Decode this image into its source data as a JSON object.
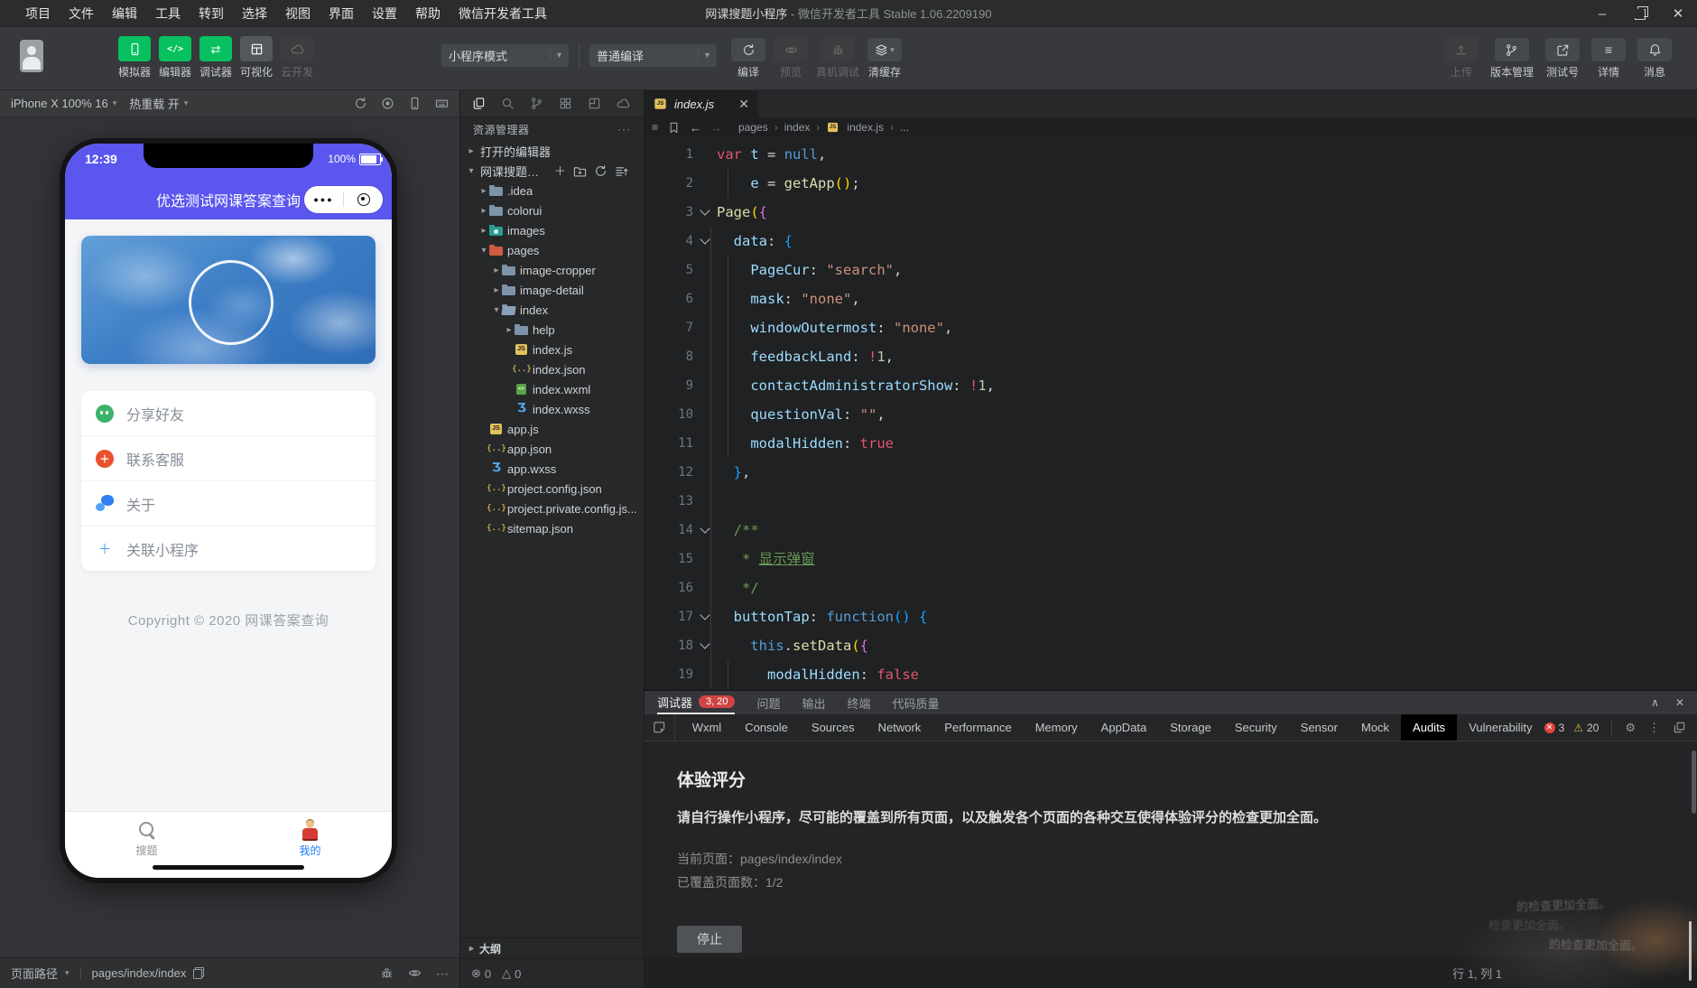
{
  "colors": {
    "accent_green": "#07c160",
    "phone_header_purple": "#5a56ee",
    "badge_red": "#d04444",
    "error_red": "#e2443f",
    "warning_yellow": "#e2b341",
    "active_tab_blue": "#1f7bf6"
  },
  "titlebar": {
    "menus": [
      "项目",
      "文件",
      "编辑",
      "工具",
      "转到",
      "选择",
      "视图",
      "界面",
      "设置",
      "帮助",
      "微信开发者工具"
    ],
    "title_main": "网课搜题小程序",
    "title_rest": "- 微信开发者工具 Stable 1.06.2209190"
  },
  "toolbar": {
    "big_buttons": [
      {
        "label": "模拟器",
        "icon": "device",
        "style": "green"
      },
      {
        "label": "编辑器",
        "icon": "code",
        "style": "green"
      },
      {
        "label": "调试器",
        "icon": "swap",
        "style": "green"
      },
      {
        "label": "可视化",
        "icon": "grid",
        "style": "gray"
      },
      {
        "label": "云开发",
        "icon": "cloud",
        "style": "disabled"
      }
    ],
    "mode_select": "小程序模式",
    "compile_select": "普通编译",
    "action_buttons": [
      {
        "label": "编译",
        "icon": "refresh",
        "state": "normal",
        "caret": false
      },
      {
        "label": "预览",
        "icon": "eye",
        "state": "disabled",
        "caret": false
      },
      {
        "label": "真机调试",
        "icon": "bug",
        "state": "disabled",
        "caret": false
      },
      {
        "label": "清缓存",
        "icon": "layers",
        "state": "normal",
        "caret": true
      }
    ],
    "right_buttons": [
      {
        "label": "上传",
        "icon": "upload",
        "state": "disabled"
      },
      {
        "label": "版本管理",
        "icon": "branch",
        "state": "normal"
      },
      {
        "label": "测试号",
        "icon": "extern",
        "state": "normal"
      },
      {
        "label": "详情",
        "icon": "list",
        "state": "normal"
      },
      {
        "label": "消息",
        "icon": "bell",
        "state": "normal"
      }
    ]
  },
  "simulator": {
    "device_label": "iPhone X 100% 16",
    "hot_reload_label": "热重载 开",
    "phone": {
      "time": "12:39",
      "battery": "100%",
      "nav_title": "优选测试网课答案查询",
      "menu": [
        {
          "label": "分享好友",
          "icon": "share"
        },
        {
          "label": "联系客服",
          "icon": "contact"
        },
        {
          "label": "关于",
          "icon": "about"
        },
        {
          "label": "关联小程序",
          "icon": "plus"
        }
      ],
      "copyright": "Copyright © 2020 网课答案查询",
      "tabbar": [
        {
          "label": "搜题",
          "icon": "search",
          "active": false
        },
        {
          "label": "我的",
          "icon": "me",
          "active": true
        }
      ]
    },
    "status": {
      "path_label": "页面路径",
      "path": "pages/index/index"
    }
  },
  "explorer": {
    "header": "资源管理器",
    "tree": [
      {
        "label": "打开的编辑器",
        "depth": 0,
        "arrow": "right",
        "icon": ""
      },
      {
        "label": "网课搜题小...",
        "depth": 0,
        "arrow": "down",
        "icon": "",
        "root": true
      },
      {
        "label": ".idea",
        "depth": 1,
        "arrow": "right",
        "icon": "folder"
      },
      {
        "label": "colorui",
        "depth": 1,
        "arrow": "right",
        "icon": "folder"
      },
      {
        "label": "images",
        "depth": 1,
        "arrow": "right",
        "icon": "folder-images"
      },
      {
        "label": "pages",
        "depth": 1,
        "arrow": "down",
        "icon": "folder-pages"
      },
      {
        "label": "image-cropper",
        "depth": 2,
        "arrow": "right",
        "icon": "folder"
      },
      {
        "label": "image-detail",
        "depth": 2,
        "arrow": "right",
        "icon": "folder"
      },
      {
        "label": "index",
        "depth": 2,
        "arrow": "down",
        "icon": "folder-open"
      },
      {
        "label": "help",
        "depth": 3,
        "arrow": "right",
        "icon": "folder"
      },
      {
        "label": "index.js",
        "depth": 3,
        "arrow": "",
        "icon": "js"
      },
      {
        "label": "index.json",
        "depth": 3,
        "arrow": "",
        "icon": "json"
      },
      {
        "label": "index.wxml",
        "depth": 3,
        "arrow": "",
        "icon": "wxml"
      },
      {
        "label": "index.wxss",
        "depth": 3,
        "arrow": "",
        "icon": "wxss"
      },
      {
        "label": "app.js",
        "depth": 1,
        "arrow": "",
        "icon": "js"
      },
      {
        "label": "app.json",
        "depth": 1,
        "arrow": "",
        "icon": "json"
      },
      {
        "label": "app.wxss",
        "depth": 1,
        "arrow": "",
        "icon": "wxss"
      },
      {
        "label": "project.config.json",
        "depth": 1,
        "arrow": "",
        "icon": "json"
      },
      {
        "label": "project.private.config.js...",
        "depth": 1,
        "arrow": "",
        "icon": "json"
      },
      {
        "label": "sitemap.json",
        "depth": 1,
        "arrow": "",
        "icon": "json"
      }
    ],
    "outline_label": "大纲",
    "problems": {
      "errors": "0",
      "warnings": "0"
    }
  },
  "editor": {
    "tab": "index.js",
    "breadcrumb": [
      "pages",
      "index",
      "index.js",
      "..."
    ],
    "folds": [
      3,
      4,
      14,
      17,
      18
    ],
    "code": [
      [
        [
          "k",
          "var"
        ],
        [
          "p",
          " "
        ],
        [
          "v",
          "t"
        ],
        [
          "p",
          " = "
        ],
        [
          "b",
          "null"
        ],
        [
          "p",
          ","
        ]
      ],
      [
        [
          "p",
          "    "
        ],
        [
          "v",
          "e"
        ],
        [
          "p",
          " = "
        ],
        [
          "f",
          "getApp"
        ],
        [
          "g1",
          "()"
        ],
        [
          "p",
          ";"
        ]
      ],
      [
        [
          "f",
          "Page"
        ],
        [
          "g1",
          "("
        ],
        [
          "g2",
          "{"
        ]
      ],
      [
        [
          "p",
          "  "
        ],
        [
          "v",
          "data"
        ],
        [
          "p",
          ": "
        ],
        [
          "g3",
          "{"
        ]
      ],
      [
        [
          "p",
          "    "
        ],
        [
          "v",
          "PageCur"
        ],
        [
          "p",
          ": "
        ],
        [
          "s",
          "\"search\""
        ],
        [
          "p",
          ","
        ]
      ],
      [
        [
          "p",
          "    "
        ],
        [
          "v",
          "mask"
        ],
        [
          "p",
          ": "
        ],
        [
          "s",
          "\"none\""
        ],
        [
          "p",
          ","
        ]
      ],
      [
        [
          "p",
          "    "
        ],
        [
          "v",
          "windowOutermost"
        ],
        [
          "p",
          ": "
        ],
        [
          "s",
          "\"none\""
        ],
        [
          "p",
          ","
        ]
      ],
      [
        [
          "p",
          "    "
        ],
        [
          "v",
          "feedbackLand"
        ],
        [
          "p",
          ": "
        ],
        [
          "k",
          "!"
        ],
        [
          "n",
          "1"
        ],
        [
          "p",
          ","
        ]
      ],
      [
        [
          "p",
          "    "
        ],
        [
          "v",
          "contactAdministratorShow"
        ],
        [
          "p",
          ": "
        ],
        [
          "k",
          "!"
        ],
        [
          "n",
          "1"
        ],
        [
          "p",
          ","
        ]
      ],
      [
        [
          "p",
          "    "
        ],
        [
          "v",
          "questionVal"
        ],
        [
          "p",
          ": "
        ],
        [
          "s",
          "\"\""
        ],
        [
          "p",
          ","
        ]
      ],
      [
        [
          "p",
          "    "
        ],
        [
          "v",
          "modalHidden"
        ],
        [
          "p",
          ": "
        ],
        [
          "k",
          "true"
        ]
      ],
      [
        [
          "p",
          "  "
        ],
        [
          "g3",
          "}"
        ],
        [
          "p",
          ","
        ]
      ],
      [],
      [
        [
          "p",
          "  "
        ],
        [
          "c",
          "/**"
        ]
      ],
      [
        [
          "p",
          "  "
        ],
        [
          "c",
          " * "
        ],
        [
          "cu",
          "显示弹窗"
        ]
      ],
      [
        [
          "p",
          "  "
        ],
        [
          "c",
          " */"
        ]
      ],
      [
        [
          "p",
          "  "
        ],
        [
          "v",
          "buttonTap"
        ],
        [
          "p",
          ": "
        ],
        [
          "b",
          "function"
        ],
        [
          "g3",
          "()"
        ],
        [
          "p",
          " "
        ],
        [
          "g3",
          "{"
        ]
      ],
      [
        [
          "p",
          "    "
        ],
        [
          "b",
          "this"
        ],
        [
          "p",
          "."
        ],
        [
          "f",
          "setData"
        ],
        [
          "g1",
          "("
        ],
        [
          "g2",
          "{"
        ]
      ],
      [
        [
          "p",
          "      "
        ],
        [
          "v",
          "modalHidden"
        ],
        [
          "p",
          ": "
        ],
        [
          "k",
          "false"
        ]
      ]
    ]
  },
  "debugger": {
    "tabs": [
      {
        "label": "调试器",
        "badge": "3, 20",
        "active": true
      },
      {
        "label": "问题",
        "badge": "",
        "active": false
      },
      {
        "label": "输出",
        "badge": "",
        "active": false
      },
      {
        "label": "终端",
        "badge": "",
        "active": false
      },
      {
        "label": "代码质量",
        "badge": "",
        "active": false
      }
    ],
    "devtools_tabs": [
      "Wxml",
      "Console",
      "Sources",
      "Network",
      "Performance",
      "Memory",
      "AppData",
      "Storage",
      "Security",
      "Sensor",
      "Mock",
      "Audits",
      "Vulnerability"
    ],
    "devtools_active": "Audits",
    "error_count": "3",
    "warning_count": "20",
    "audits": {
      "title": "体验评分",
      "desc": "请自行操作小程序，尽可能的覆盖到所有页面，以及触发各个页面的各种交互使得体验评分的检查更加全面。",
      "current_line": "当前页面：pages/index/index",
      "covered_line": "已覆盖页面数：1/2",
      "stop_label": "停止"
    }
  },
  "statusbar": {
    "cursor_position": "行 1, 列 1"
  },
  "watermark": {
    "lines": [
      "的检查更加全面。",
      "检查更加全面。",
      "的检查更加全面。"
    ]
  }
}
